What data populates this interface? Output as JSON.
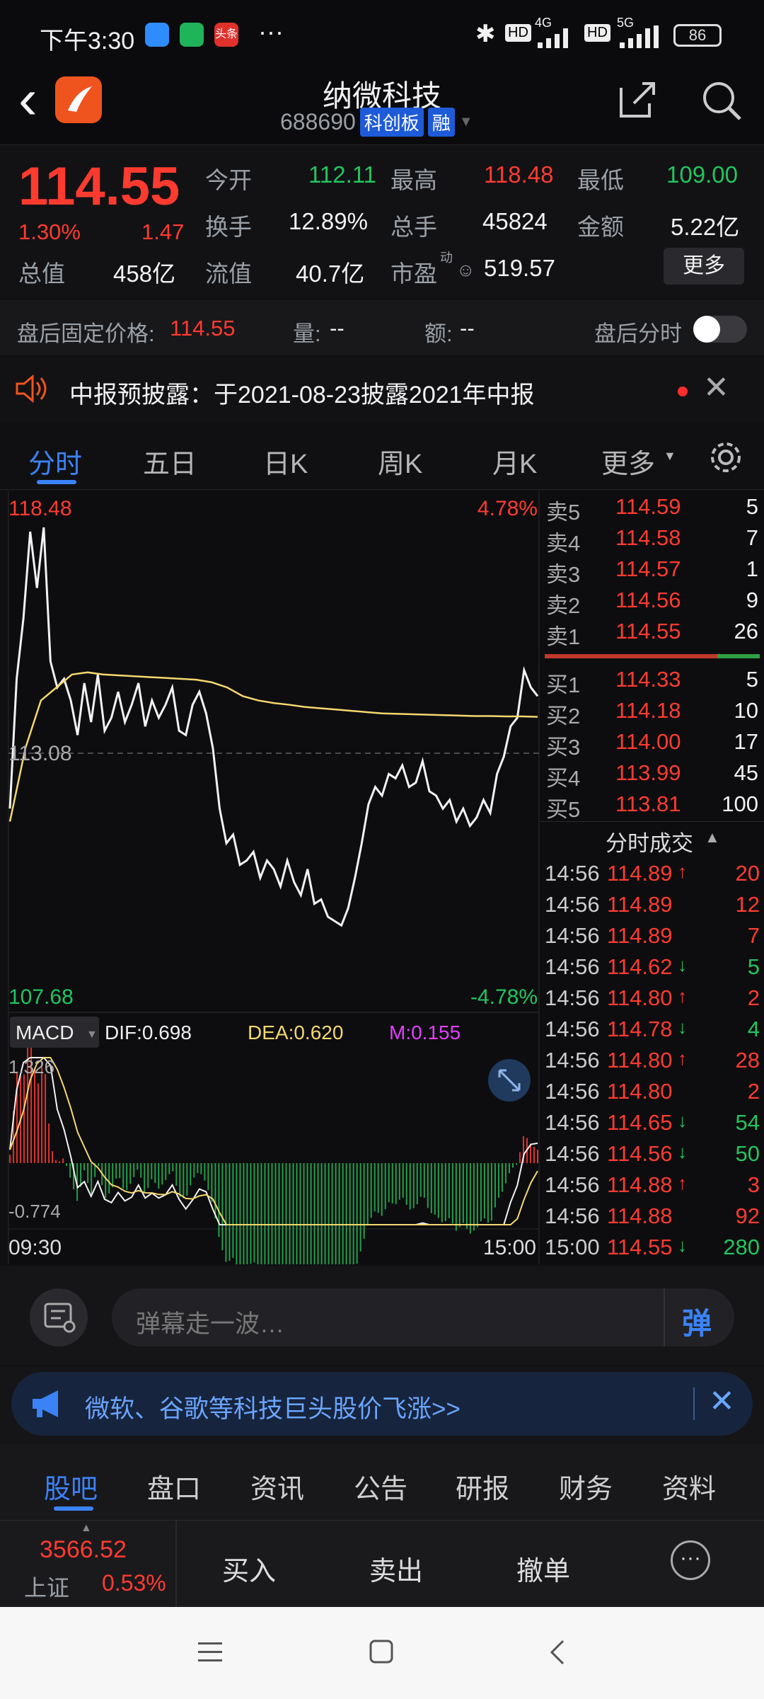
{
  "status": {
    "time": "下午3:30",
    "more": "···",
    "hd1": "HD",
    "net1": "4G",
    "hd2": "HD",
    "net2": "5G",
    "battery": "86"
  },
  "header": {
    "back": "‹",
    "name": "纳微科技",
    "code": "688690",
    "board": "科创板",
    "margin": "融",
    "share_icon": "share-icon",
    "search_icon": "search-icon"
  },
  "quote": {
    "price": "114.55",
    "change_pct": "1.30%",
    "change": "1.47",
    "open_label": "今开",
    "open": "112.11",
    "high_label": "最高",
    "high": "118.48",
    "low_label": "最低",
    "low": "109.00",
    "turnover_label": "换手",
    "turnover": "12.89%",
    "volume_label": "总手",
    "volume": "45824",
    "amount_label": "金额",
    "amount": "5.22亿",
    "mktcap_label": "总值",
    "mktcap": "458亿",
    "float_label": "流值",
    "float": "40.7亿",
    "pe_label": "市盈",
    "pe_sup": "动",
    "pe": "519.57",
    "more_btn": "更多"
  },
  "afterhours": {
    "label": "盘后固定价格:",
    "price": "114.55",
    "vol_label": "量:",
    "vol": "--",
    "amt_label": "额:",
    "amt": "--",
    "toggle_label": "盘后分时"
  },
  "notice": {
    "text": "中报预披露：于2021-08-23披露2021年中报"
  },
  "tabs": [
    "分时",
    "五日",
    "日K",
    "周K",
    "月K",
    "更多"
  ],
  "chart_data": {
    "type": "line",
    "y_top": "118.48",
    "y_top_pct": "4.78%",
    "y_bottom": "107.68",
    "y_bottom_pct": "-4.78%",
    "y_mid": "113.08",
    "ylim": [
      107.68,
      118.48
    ],
    "prev_close": 113.08,
    "x_start": "09:30",
    "x_end": "15:00",
    "price_series": [
      111.8,
      114.8,
      116.2,
      118.2,
      116.9,
      118.3,
      115.2,
      114.6,
      114.8,
      114.3,
      113.5,
      114.7,
      113.8,
      114.9,
      113.6,
      113.9,
      114.5,
      113.8,
      114.2,
      114.7,
      113.7,
      114.3,
      113.9,
      114.2,
      114.6,
      113.6,
      113.5,
      114.2,
      114.5,
      114.0,
      113.2,
      111.8,
      111.0,
      111.2,
      110.5,
      110.6,
      110.8,
      110.2,
      110.6,
      110.4,
      110.0,
      110.6,
      110.1,
      109.8,
      110.4,
      109.6,
      109.7,
      109.3,
      109.2,
      109.1,
      109.5,
      110.2,
      111.0,
      111.9,
      112.3,
      112.1,
      112.6,
      112.5,
      112.8,
      112.3,
      112.4,
      112.9,
      112.2,
      112.1,
      111.8,
      112.0,
      111.5,
      111.8,
      111.4,
      111.6,
      112.0,
      111.7,
      112.6,
      113.0,
      113.7,
      113.9,
      115.0,
      114.6,
      114.4
    ],
    "avg_series": [
      111.5,
      113.2,
      114.3,
      114.6,
      114.9,
      114.95,
      114.9,
      114.88,
      114.86,
      114.84,
      114.82,
      114.8,
      114.78,
      114.72,
      114.6,
      114.4,
      114.3,
      114.24,
      114.2,
      114.15,
      114.12,
      114.09,
      114.06,
      114.03,
      114.0,
      113.99,
      113.98,
      113.97,
      113.96,
      113.95,
      113.94,
      113.94,
      113.93,
      113.93,
      113.92
    ],
    "macd": {
      "label": "MACD",
      "dif_label": "DIF:0.698",
      "dea_label": "DEA:0.620",
      "m_label": "M:0.155",
      "top": "1.326",
      "bottom": "-0.774",
      "ylim": [
        -0.774,
        1.326
      ]
    }
  },
  "orderbook": {
    "asks": [
      {
        "label": "卖5",
        "price": "114.59",
        "vol": "5"
      },
      {
        "label": "卖4",
        "price": "114.58",
        "vol": "7"
      },
      {
        "label": "卖3",
        "price": "114.57",
        "vol": "1"
      },
      {
        "label": "卖2",
        "price": "114.56",
        "vol": "9"
      },
      {
        "label": "卖1",
        "price": "114.55",
        "vol": "26"
      }
    ],
    "bids": [
      {
        "label": "买1",
        "price": "114.33",
        "vol": "5"
      },
      {
        "label": "买2",
        "price": "114.18",
        "vol": "10"
      },
      {
        "label": "买3",
        "price": "114.00",
        "vol": "17"
      },
      {
        "label": "买4",
        "price": "113.99",
        "vol": "45"
      },
      {
        "label": "买5",
        "price": "113.81",
        "vol": "100"
      }
    ],
    "trades_title": "分时成交",
    "trades": [
      {
        "t": "14:56",
        "p": "114.89",
        "d": "↑",
        "v": "20",
        "c": "red"
      },
      {
        "t": "14:56",
        "p": "114.89",
        "d": "",
        "v": "12",
        "c": "red"
      },
      {
        "t": "14:56",
        "p": "114.89",
        "d": "",
        "v": "7",
        "c": "red"
      },
      {
        "t": "14:56",
        "p": "114.62",
        "d": "↓",
        "v": "5",
        "c": "green"
      },
      {
        "t": "14:56",
        "p": "114.80",
        "d": "↑",
        "v": "2",
        "c": "red"
      },
      {
        "t": "14:56",
        "p": "114.78",
        "d": "↓",
        "v": "4",
        "c": "green"
      },
      {
        "t": "14:56",
        "p": "114.80",
        "d": "↑",
        "v": "28",
        "c": "red"
      },
      {
        "t": "14:56",
        "p": "114.80",
        "d": "",
        "v": "2",
        "c": "red"
      },
      {
        "t": "14:56",
        "p": "114.65",
        "d": "↓",
        "v": "54",
        "c": "green"
      },
      {
        "t": "14:56",
        "p": "114.56",
        "d": "↓",
        "v": "50",
        "c": "green"
      },
      {
        "t": "14:56",
        "p": "114.88",
        "d": "↑",
        "v": "3",
        "c": "red"
      },
      {
        "t": "14:56",
        "p": "114.88",
        "d": "",
        "v": "92",
        "c": "red"
      },
      {
        "t": "15:00",
        "p": "114.55",
        "d": "↓",
        "v": "280",
        "c": "green"
      }
    ]
  },
  "danmaku": {
    "placeholder": "弹幕走一波…",
    "btn": "弹"
  },
  "promo": {
    "text": "微软、谷歌等科技巨头股价飞涨>>"
  },
  "bottom_tabs": [
    "股吧",
    "盘口",
    "资讯",
    "公告",
    "研报",
    "财务",
    "资料"
  ],
  "trade_bar": {
    "index_val": "3566.52",
    "index_name": "上证",
    "index_pct": "0.53%",
    "buy": "买入",
    "sell": "卖出",
    "cancel": "撤单"
  }
}
